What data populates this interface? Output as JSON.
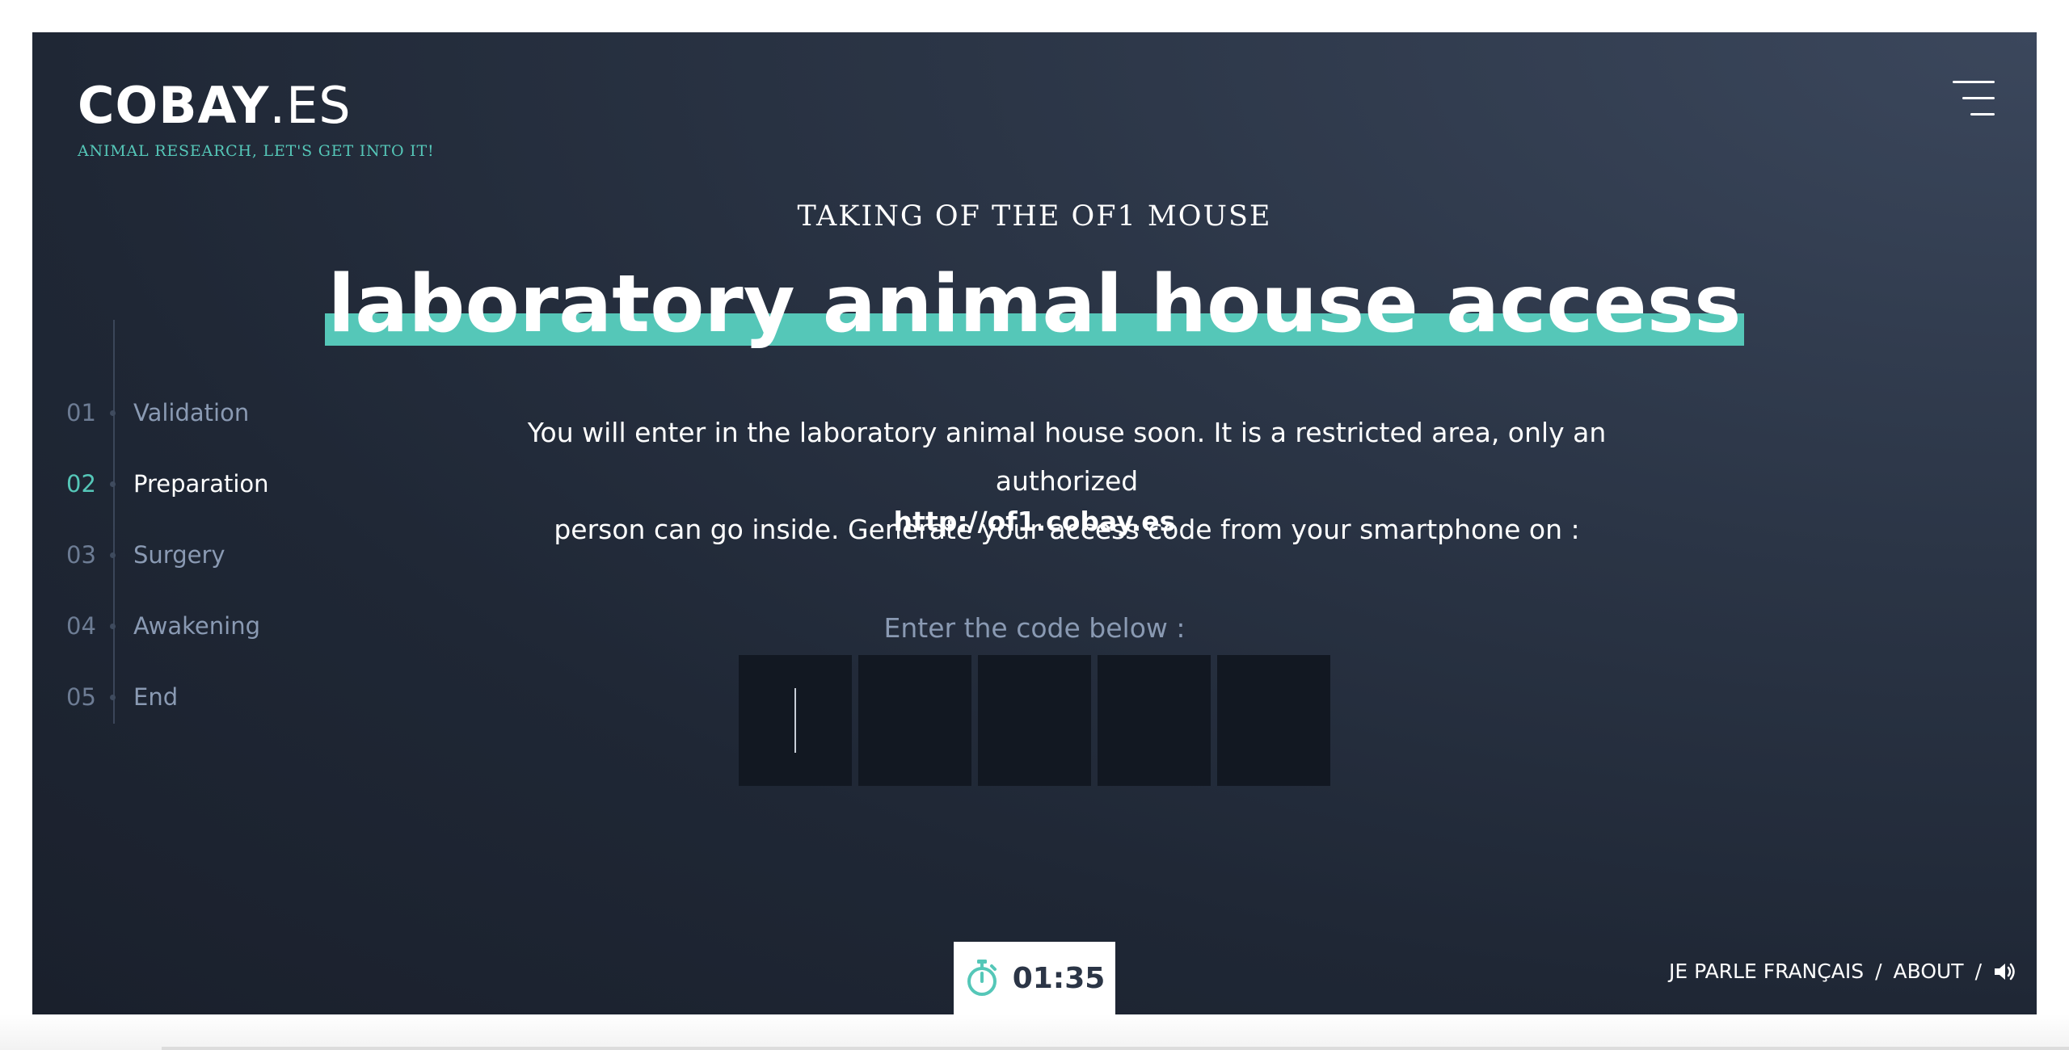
{
  "brand": {
    "name_bold": "COBAY",
    "name_light": ".ES",
    "tagline": "ANIMAL RESEARCH, LET'S GET INTO IT!"
  },
  "header": {
    "kicker": "TAKING OF THE OF1 MOUSE",
    "title": "laboratory animal house access"
  },
  "intro": {
    "line1": "You will enter in the laboratory animal house soon. It is a restricted area, only an authorized",
    "line2": "person can go inside. Generate your access code from your smartphone on :",
    "url": "http://of1.cobay.es"
  },
  "code": {
    "label": "Enter the code below :",
    "digits": [
      "",
      "",
      "",
      "",
      ""
    ]
  },
  "steps": [
    {
      "num": "01",
      "label": "Validation",
      "active": false
    },
    {
      "num": "02",
      "label": "Preparation",
      "active": true
    },
    {
      "num": "03",
      "label": "Surgery",
      "active": false
    },
    {
      "num": "04",
      "label": "Awakening",
      "active": false
    },
    {
      "num": "05",
      "label": "End",
      "active": false
    }
  ],
  "timer": {
    "value": "01:35",
    "icon": "stopwatch-icon"
  },
  "footer": {
    "language_link": "JE PARLE FRANÇAIS",
    "about_link": "ABOUT",
    "separator": "/",
    "sound_icon": "speaker-icon"
  },
  "colors": {
    "accent": "#55c7b8",
    "background_dark": "#1a202c",
    "background_light": "#3b475c",
    "muted_text": "#8a9ab3",
    "code_box": "#121822"
  }
}
